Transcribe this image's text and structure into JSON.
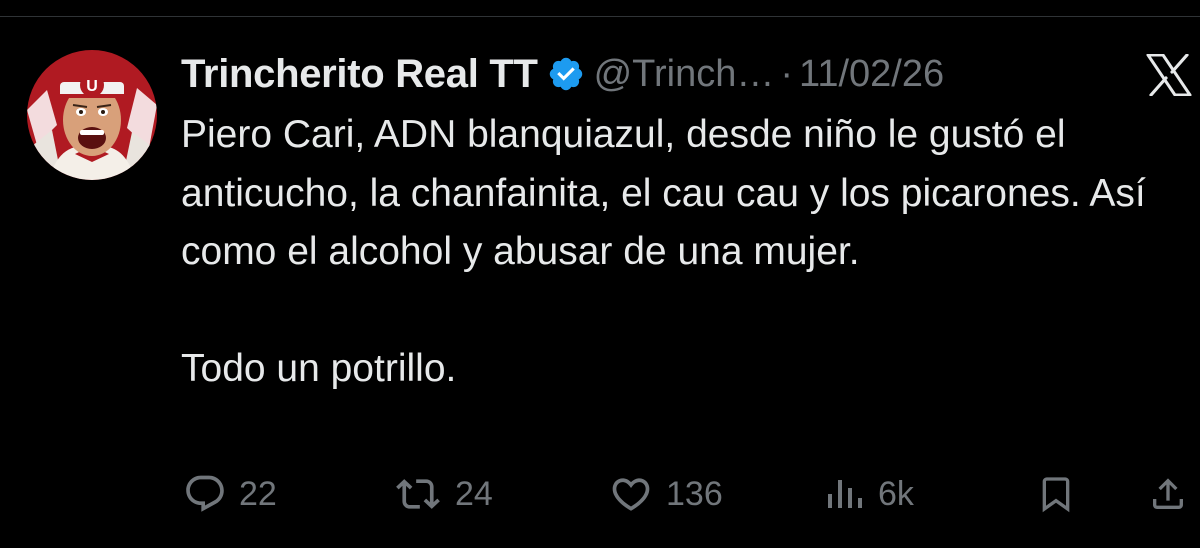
{
  "tweet": {
    "author": {
      "display_name": "Trincherito Real TT",
      "handle": "@Trinch…",
      "verified": true
    },
    "separator": "·",
    "date": "11/02/26",
    "body": {
      "paragraph_1": "Piero Cari, ADN blanquiazul, desde niño le gustó el anticucho, la chanfainita, el cau cau y los picarones. Así como el alcohol y abusar de una mujer.",
      "paragraph_2": "Todo un potrillo."
    },
    "metrics": {
      "replies": "22",
      "reposts": "24",
      "likes": "136",
      "views": "6k"
    }
  },
  "icons": {
    "platform": "x-logo-icon",
    "verified": "verified-badge-icon",
    "reply": "reply-icon",
    "repost": "repost-icon",
    "like": "heart-icon",
    "views": "views-icon",
    "bookmark": "bookmark-icon",
    "share": "share-icon"
  },
  "colors": {
    "background": "#000000",
    "text_primary": "#e7e9ea",
    "text_secondary": "#71767b",
    "verified_blue": "#1d9bf0",
    "divider": "#2f3336"
  }
}
